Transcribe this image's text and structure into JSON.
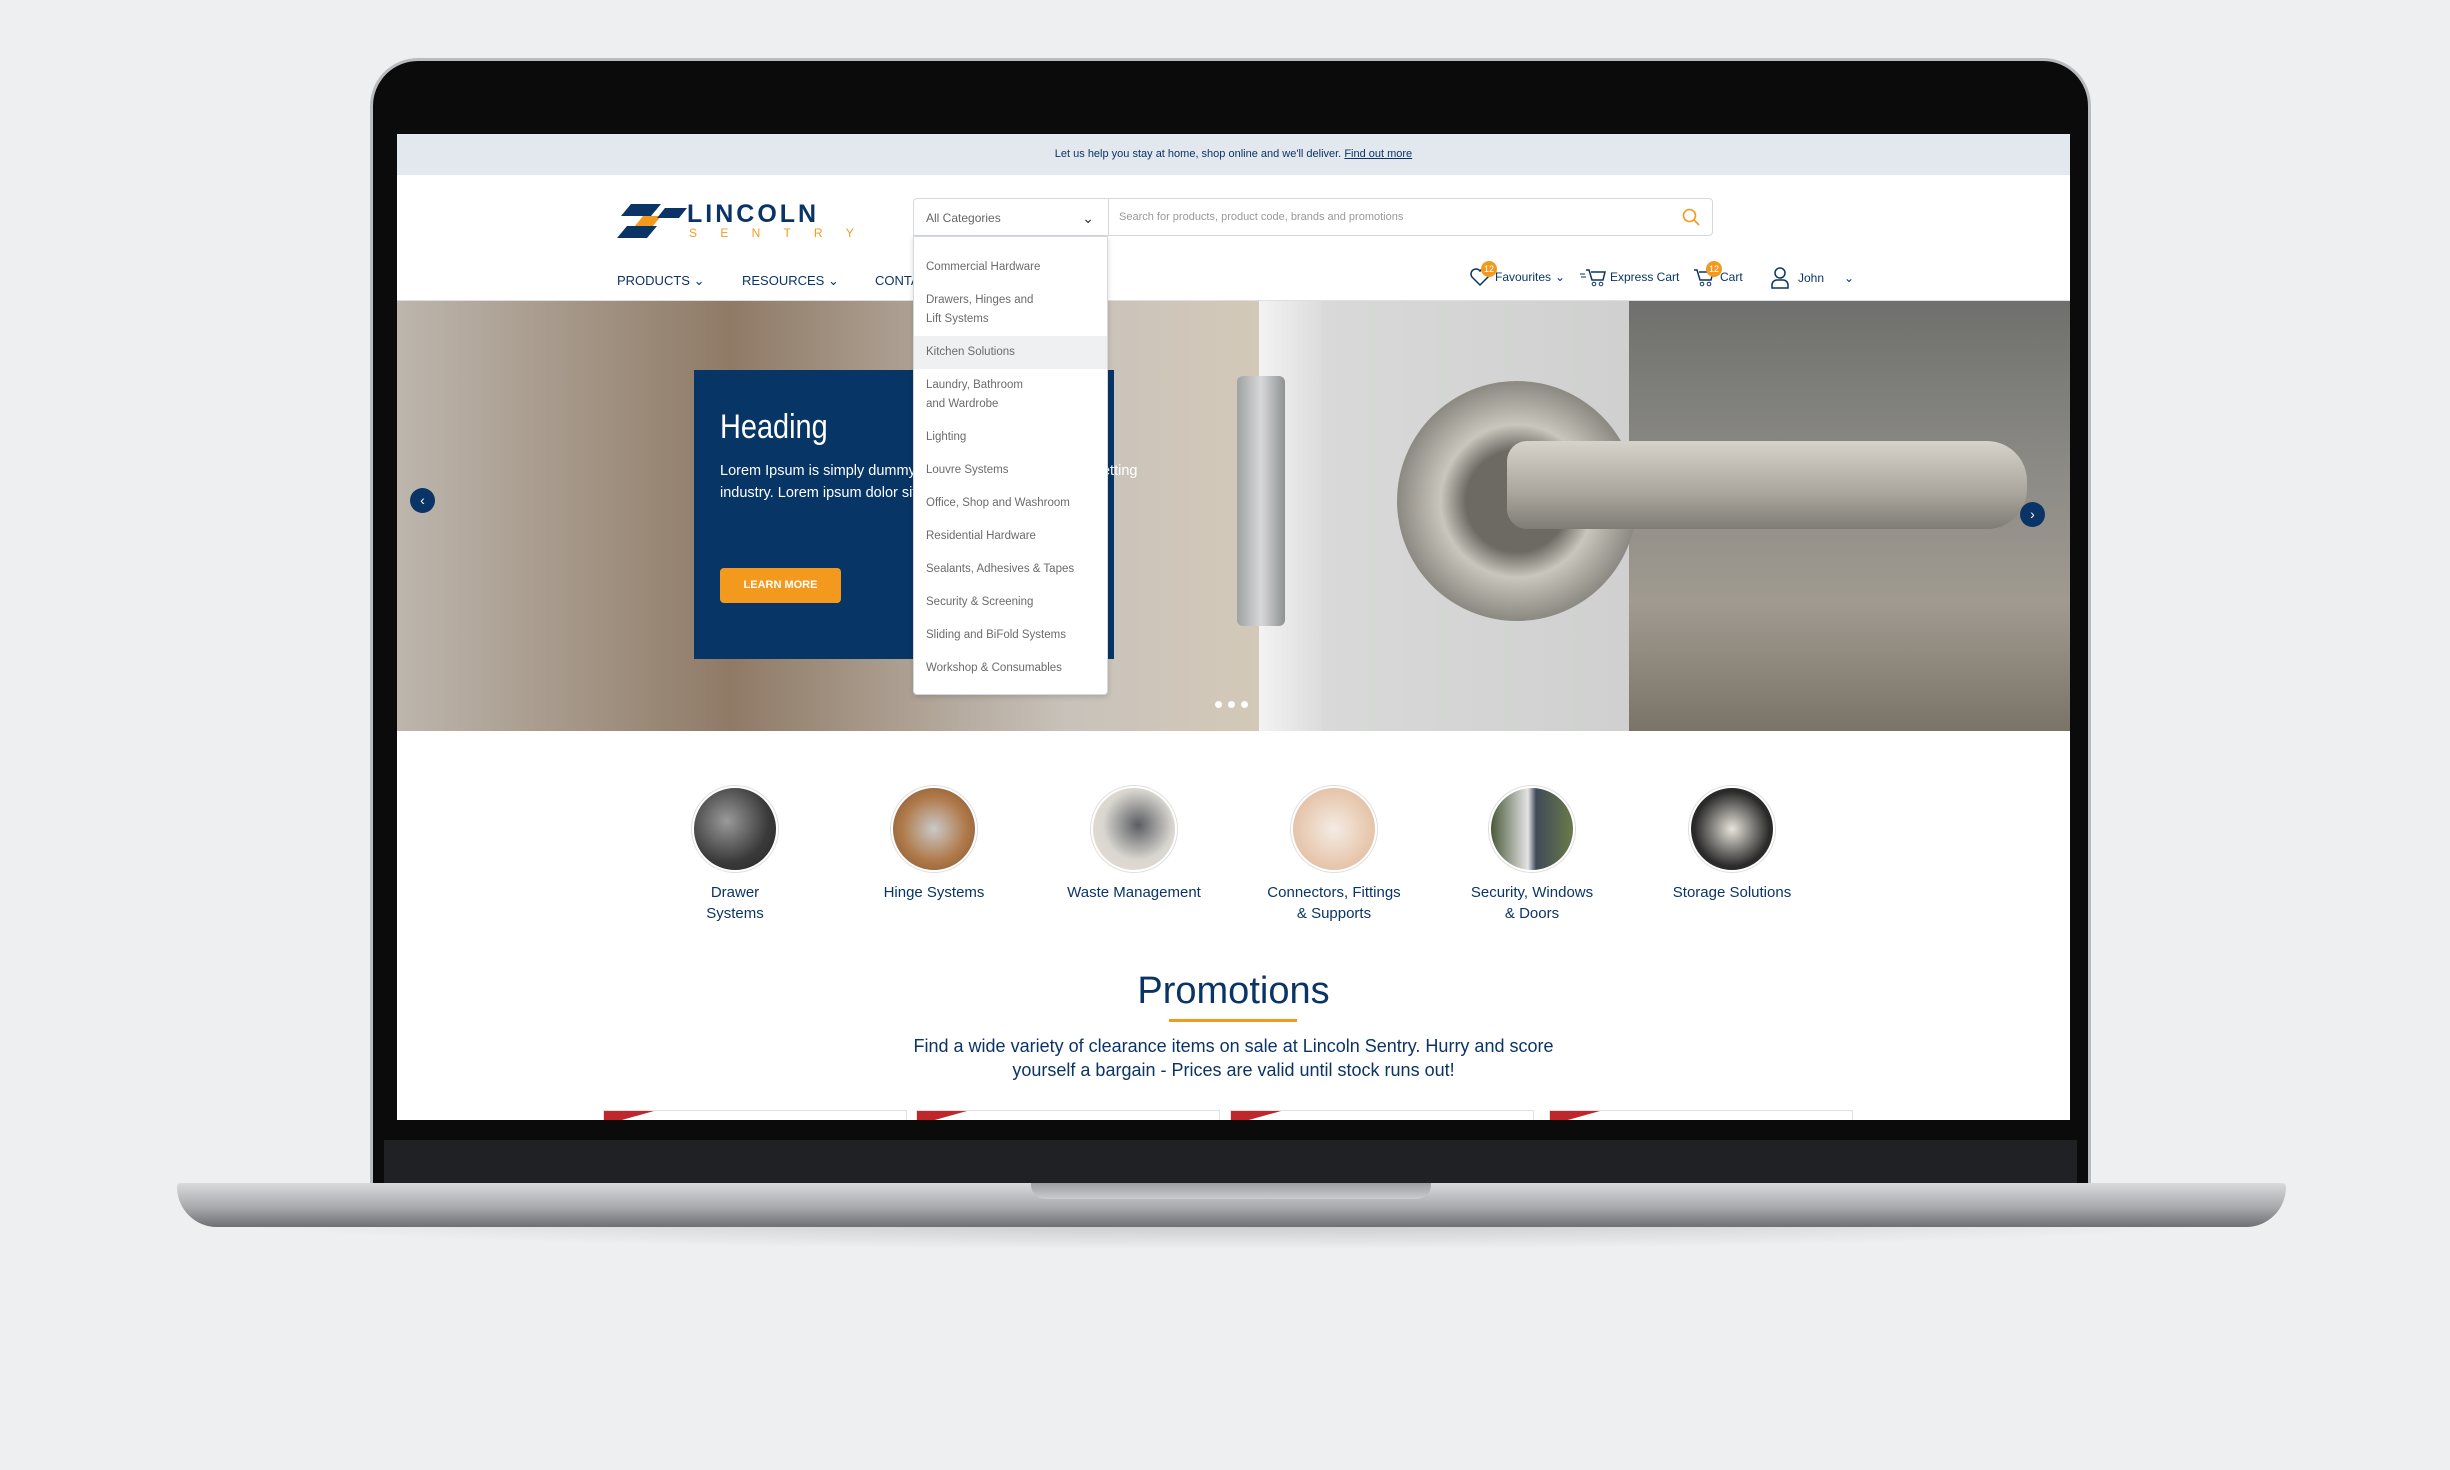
{
  "banner": {
    "text": "Let us help you stay at home, shop online and we'll deliver.",
    "link": "Find out more"
  },
  "logo": {
    "line1": "LINCOLN",
    "line2": "S E N T R Y"
  },
  "search": {
    "category": "All Categories",
    "placeholder": "Search for products, product code, brands and promotions"
  },
  "nav": {
    "products": "PRODUCTS",
    "resources": "RESOURCES",
    "contact": "CONTA"
  },
  "account": {
    "favourites": "Favourites",
    "favourites_count": "12",
    "express_cart": "Express Cart",
    "cart": "Cart",
    "cart_count": "12",
    "user": "John"
  },
  "dropdown": [
    "Commercial Hardware",
    "Drawers, Hinges and Lift Systems",
    "Kitchen Solutions",
    "Laundry, Bathroom and Wardrobe",
    "Lighting",
    "Louvre Systems",
    "Office, Shop and Washroom",
    "Residential Hardware",
    "Sealants, Adhesives & Tapes",
    "Security & Screening",
    "Sliding and BiFold Systems",
    "Workshop & Consumables"
  ],
  "dropdown_highlighted": "Kitchen Solutions",
  "hero": {
    "heading": "Heading",
    "body": "Lorem Ipsum is simply dummy text of the printing and typesetting industry. Lorem ipsum dolor sit amet, consectetur adipisicing",
    "cta": "LEARN MORE",
    "slides": 3,
    "active_slide": 1
  },
  "categories": [
    {
      "l1": "Drawer",
      "l2": "Systems"
    },
    {
      "l1": "Hinge Systems",
      "l2": ""
    },
    {
      "l1": "Waste Management",
      "l2": ""
    },
    {
      "l1": "Connectors, Fittings",
      "l2": "& Supports"
    },
    {
      "l1": "Security, Windows",
      "l2": "& Doors"
    },
    {
      "l1": "Storage Solutions",
      "l2": ""
    }
  ],
  "promotions": {
    "title": "Promotions",
    "subtitle": "Find a wide variety of clearance items on sale at Lincoln Sentry. Hurry and score yourself a bargain - Prices are valid until stock runs out!"
  },
  "colors": {
    "navy": "#073566",
    "accent": "#f39a1e",
    "sale": "#c0272d"
  }
}
